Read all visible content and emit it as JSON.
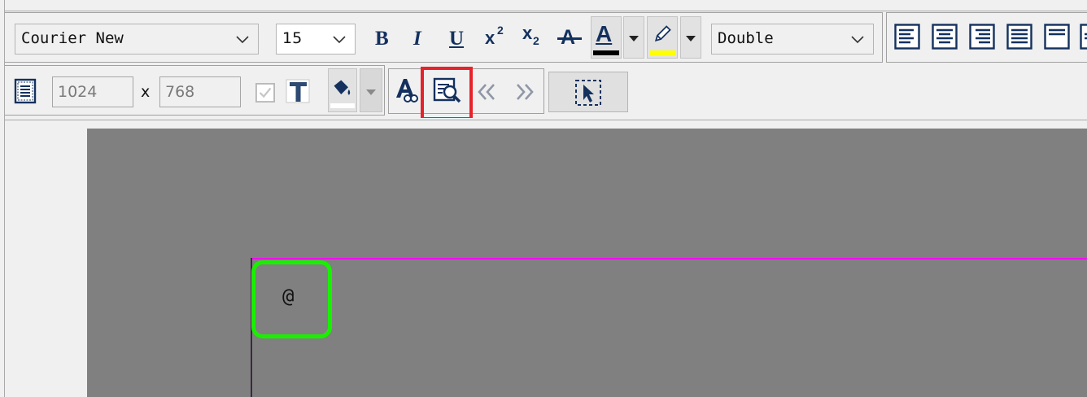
{
  "toolbar_top": {
    "font_name": "Courier New",
    "font_size": "15",
    "bold_label": "B",
    "italic_label": "I",
    "underline_label": "U",
    "superscript_label": "x",
    "superscript_mark": "2",
    "subscript_label": "x",
    "subscript_mark": "2",
    "strike_label": "A",
    "font_color_label": "A",
    "line_style": "Double",
    "colors": {
      "icon": "#14315e",
      "font_color_bar": "#000000",
      "highlight_bar": "#ffff00"
    }
  },
  "toolbar_bottom": {
    "width_value": "1024",
    "separator": "x",
    "height_value": "768"
  },
  "annotations": {
    "preview_label": "预览",
    "preview_color": "#e8222a",
    "cell_highlight_color": "#19f000"
  },
  "canvas": {
    "cell_text": "@",
    "background": "#808080",
    "border_color": "#ff00ff"
  }
}
